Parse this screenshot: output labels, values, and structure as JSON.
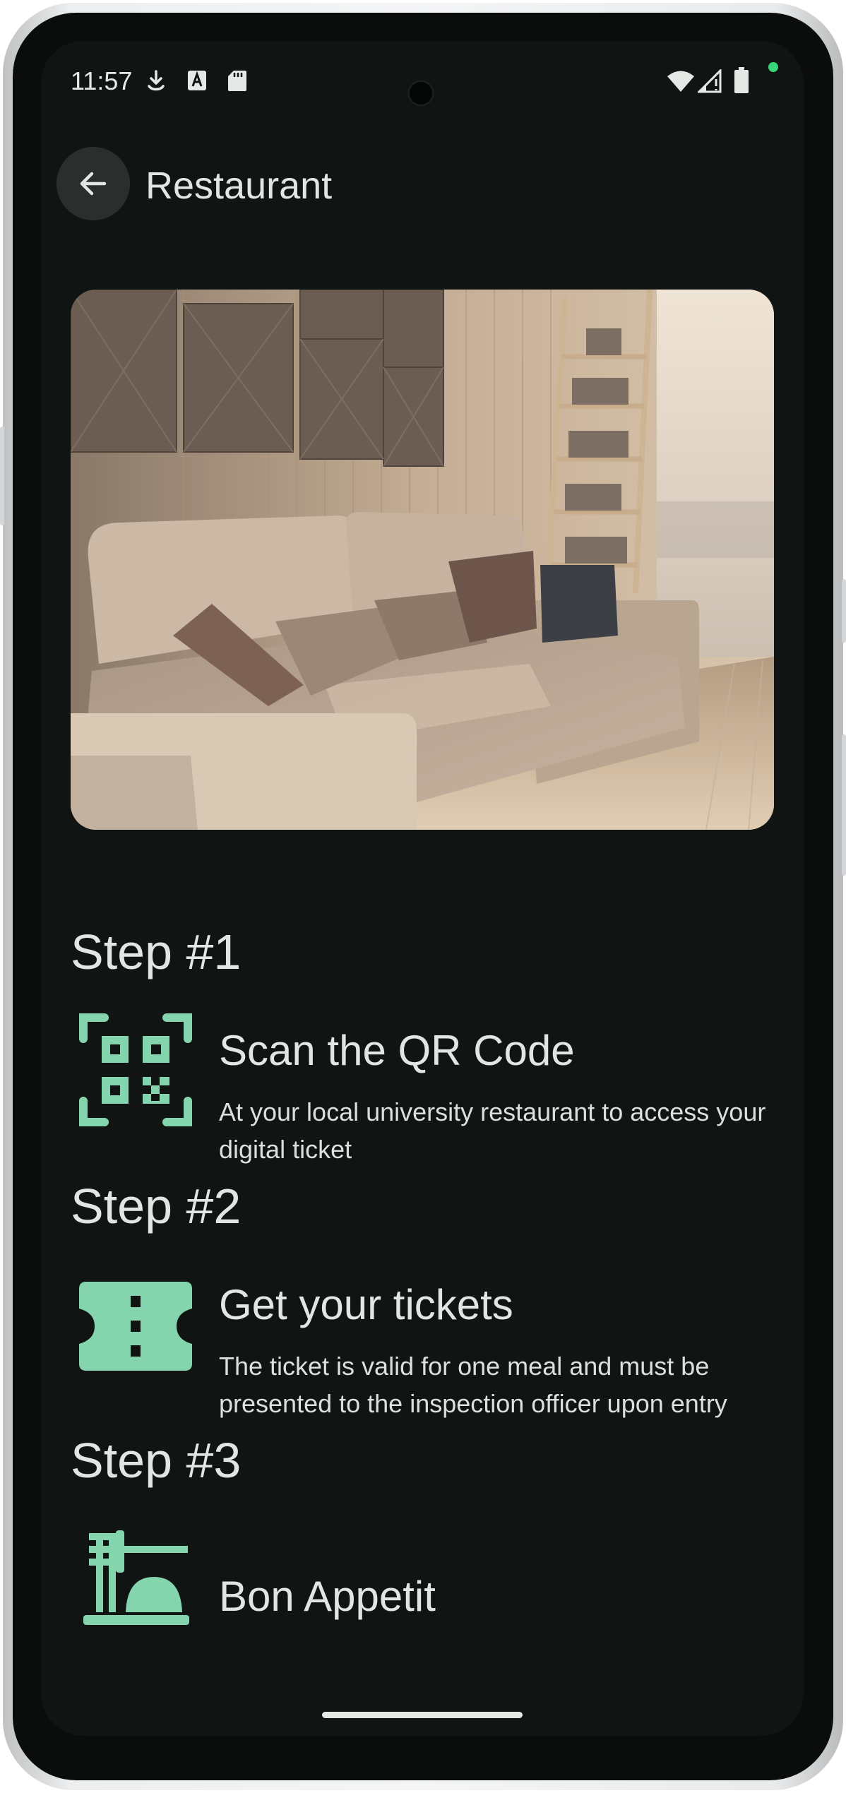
{
  "status_bar": {
    "time": "11:57",
    "left_icons": [
      "download-icon",
      "text-a-icon",
      "sd-card-icon"
    ],
    "right_icons": [
      "wifi-icon",
      "signal-icon",
      "battery-icon"
    ]
  },
  "top_bar": {
    "back_icon": "arrow-left-icon",
    "title": "Restaurant"
  },
  "hero_image": {
    "description_icon": "living-room-photo"
  },
  "steps": [
    {
      "heading": "Step #1",
      "icon": "qr-code-icon",
      "title": "Scan the QR Code",
      "description": "At your local university restaurant to access your digital ticket"
    },
    {
      "heading": "Step #2",
      "icon": "ticket-icon",
      "title": "Get your tickets",
      "description": "The ticket is valid for one meal and must be presented to the inspection officer upon entry"
    },
    {
      "heading": "Step #3",
      "icon": "food-service-icon",
      "title": "Bon Appetit",
      "description": ""
    }
  ],
  "colors": {
    "background": "#101513",
    "accent": "#84d5ad",
    "text": "#e3e5e2"
  }
}
